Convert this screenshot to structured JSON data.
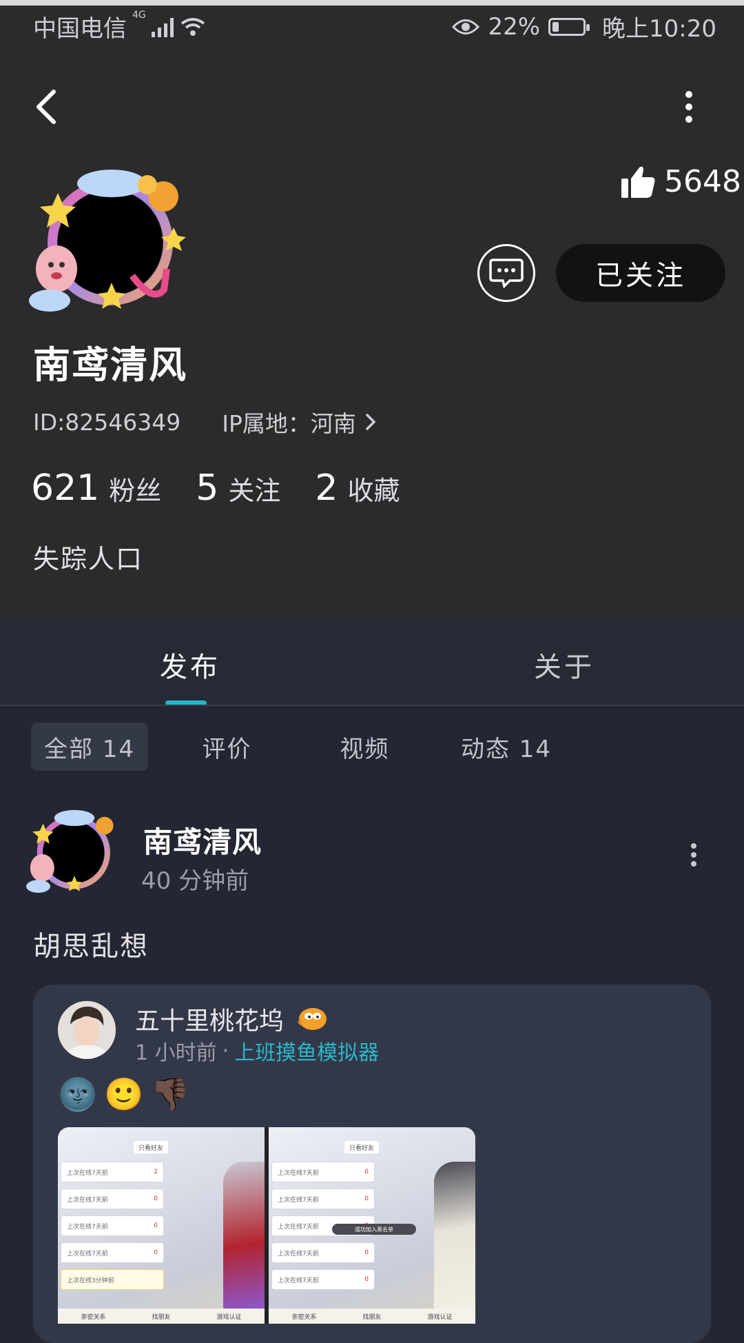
{
  "status_bar": {
    "carrier": "中国电信",
    "network": "4G",
    "battery": "22%",
    "battery_level": 0.22,
    "time": "晚上10:20"
  },
  "profile": {
    "likes": "5648",
    "follow_label": "已关注",
    "username": "南鸢清风",
    "id_text": "ID:82546349",
    "ip_text": "IP属地：河南",
    "stats": [
      {
        "num": "621",
        "label": "粉丝"
      },
      {
        "num": "5",
        "label": "关注"
      },
      {
        "num": "2",
        "label": "收藏"
      }
    ],
    "bio": "失踪人口"
  },
  "tabs": [
    {
      "label": "发布",
      "active": true
    },
    {
      "label": "关于",
      "active": false
    }
  ],
  "filters": [
    {
      "label": "全部 14",
      "active": true
    },
    {
      "label": "评价",
      "active": false
    },
    {
      "label": "视频",
      "active": false
    },
    {
      "label": "动态 14",
      "active": false
    }
  ],
  "post": {
    "author": "南鸢清风",
    "time": "40 分钟前",
    "text": "胡思乱想",
    "shared": {
      "author": "五十里桃花坞",
      "time": "1 小时前",
      "separator": "·",
      "game": "上班摸鱼模拟器",
      "emojis": [
        "🌚",
        "🙂",
        "👎🏿"
      ],
      "screens": [
        {
          "header": "只看好友",
          "rows": [
            {
              "label": "上次在线7天前",
              "count": "2"
            },
            {
              "label": "上次在线7天前",
              "count": "0"
            },
            {
              "label": "上次在线7天前",
              "count": "0"
            },
            {
              "label": "上次在线7天前",
              "count": "0"
            },
            {
              "label": "上次在线3分钟前",
              "count": ""
            }
          ],
          "bottom": [
            "亲密关系",
            "找朋友",
            "游戏认证"
          ],
          "toast": ""
        },
        {
          "header": "只看好友",
          "rows": [
            {
              "label": "上次在线7天前",
              "count": "0"
            },
            {
              "label": "上次在线7天前",
              "count": "0"
            },
            {
              "label": "上次在线7天前",
              "count": "0"
            },
            {
              "label": "上次在线7天前",
              "count": "0"
            },
            {
              "label": "上次在线7天前",
              "count": "0"
            }
          ],
          "bottom": [
            "亲密关系",
            "找朋友",
            "游戏认证"
          ],
          "toast": "成功加入黑名单"
        }
      ]
    }
  }
}
